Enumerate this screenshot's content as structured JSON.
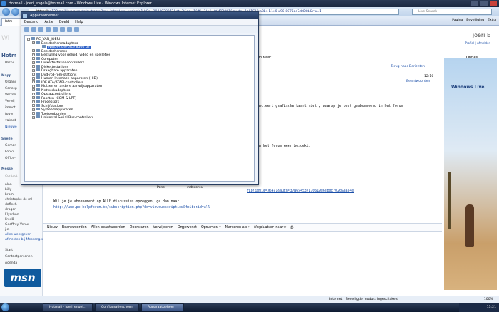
{
  "ie": {
    "title": "Hotmail - joeri_engels@hotmail.com - Windows Live - Windows Internet Explorer",
    "address_prefix": "https://",
    "address": "sn120.mail.live.com/default.aspx?rru=inbox&wa=wsignin1.0&n=1844928072&dt=3&bn=1&fti=1&ui=96412081&mode=1c41810-a814-11e0-a90-8075ad7dd08b&rru=1",
    "search_placeholder": "Live Search",
    "tab_label": "Hotm",
    "tools": [
      "Pagina",
      "Beveiliging",
      "Extra"
    ],
    "status_zone": "Internet | Beveiligde modus: ingeschakeld",
    "zoom": "100%"
  },
  "page": {
    "brand": "Wi",
    "hotmail": "Hotm",
    "postvak": "Postv",
    "user": "joeri E",
    "profiel": "Profiel | Afmelden",
    "forum_naar": "rum naar",
    "opties": "Opties",
    "terug": "Terug naar Berichten",
    "time": "12:10",
    "beantwoorden": "Beantwoorden",
    "body_line1": "er detecteert grafische kaart niet , waarop je best geabonneerd in het forum",
    "body_line2": "rdat je het forum weer bezoekt.",
    "body_link": "riptionid=76451&auth=37a654537170619e6db0c7026&aaa4e",
    "panel": "Panel",
    "indexeren": "indexeren",
    "abonnement": "Wil je je abonnement op ALLE discussies opzeggen, ga dan naar:",
    "abonnement_link": "http://www.pc-helpforum.be/subscription.php?do=viewsubscription&folderid=all",
    "actions": [
      "Nieuw",
      "Beantwoorden",
      "Allen beantwoorden",
      "Doorsturen",
      "Verwijderen",
      "Ongewenst",
      "Opruimen ▾",
      "Markeren als ▾",
      "Verplaatsen naar ▾"
    ],
    "left_sections": {
      "mappen": "Mapp",
      "mappen_items": [
        "Organi",
        "Concep",
        "Verzon",
        "Verwij",
        "immot",
        "touw",
        "vakant",
        "Nieuwe"
      ],
      "snel": "Snelle",
      "snel_items": [
        "Gemar",
        "Foto's",
        "Office-"
      ],
      "messenger": "Messe",
      "messenger_items": [
        "Contact",
        "alan",
        "billy",
        "bram",
        "christophe de ml",
        "daflech",
        "dragon",
        "Flyerban",
        "Fred8",
        "Geoffrey Venus",
        "j.c."
      ],
      "links": [
        "Alles weergeven",
        "Afmelden bij Messenger"
      ],
      "bottom_links": [
        "Start",
        "Contactpersonen",
        "Agenda"
      ]
    },
    "msn": "msn",
    "ad_brand": "Windows Live"
  },
  "devmgr": {
    "title": "Apparaatbeheer",
    "menu": [
      "Bestand",
      "Actie",
      "Beeld",
      "Help"
    ],
    "root": "PC_VAN_JOERI",
    "tree": [
      {
        "label": "Beeldschermadapters",
        "level": 1,
        "expanded": true
      },
      {
        "label": "NVIDIA GeForce 8500 GT",
        "level": 2,
        "selected": true
      },
      {
        "label": "Beeldschermen",
        "level": 1
      },
      {
        "label": "Besturing voor geluid, video en spelletjes",
        "level": 1
      },
      {
        "label": "Computer",
        "level": 1
      },
      {
        "label": "Diskettestationcontrollers",
        "level": 1
      },
      {
        "label": "Diskettestations",
        "level": 1
      },
      {
        "label": "Draagbare apparaten",
        "level": 1
      },
      {
        "label": "Dvd-/cd-rom-stations",
        "level": 1
      },
      {
        "label": "Human Interface-apparaten (HID)",
        "level": 1
      },
      {
        "label": "IDE ATA/ATAPI-controllers",
        "level": 1
      },
      {
        "label": "Muizen en andere aanwijsapparaten",
        "level": 1
      },
      {
        "label": "Netwerkadapters",
        "level": 1
      },
      {
        "label": "Opslagcontrollers",
        "level": 1
      },
      {
        "label": "Poorten (COM & LPT)",
        "level": 1
      },
      {
        "label": "Processors",
        "level": 1
      },
      {
        "label": "Schijfstations",
        "level": 1
      },
      {
        "label": "Systeemapparaten",
        "level": 1
      },
      {
        "label": "Toetsenborden",
        "level": 1
      },
      {
        "label": "Universal Serial Bus-controllers",
        "level": 1
      }
    ]
  },
  "taskbar": {
    "tasks": [
      "Hotmail - joeri_engel...",
      "Configuratiescherm",
      "Apparaatbeheer"
    ],
    "clock": "13:21"
  }
}
